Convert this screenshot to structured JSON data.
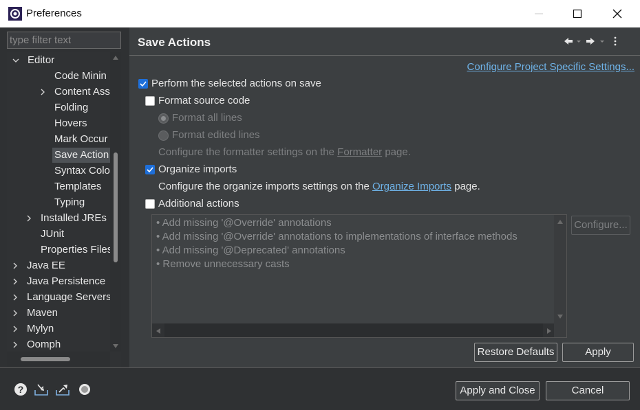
{
  "window": {
    "title": "Preferences"
  },
  "filter": {
    "placeholder": "type filter text"
  },
  "tree": {
    "items": [
      {
        "label": "Editor"
      },
      {
        "label": "Code Minin"
      },
      {
        "label": "Content Ass"
      },
      {
        "label": "Folding"
      },
      {
        "label": "Hovers"
      },
      {
        "label": "Mark Occur"
      },
      {
        "label": "Save Action"
      },
      {
        "label": "Syntax Colo"
      },
      {
        "label": "Templates"
      },
      {
        "label": "Typing"
      },
      {
        "label": "Installed JREs"
      },
      {
        "label": "JUnit"
      },
      {
        "label": "Properties Files"
      },
      {
        "label": "Java EE"
      },
      {
        "label": "Java Persistence"
      },
      {
        "label": "Language Servers"
      },
      {
        "label": "Maven"
      },
      {
        "label": "Mylyn"
      },
      {
        "label": "Oomph"
      }
    ],
    "selected": "Save Action"
  },
  "page": {
    "title": "Save Actions",
    "project_link": "Configure Project Specific Settings...",
    "perform_label": "Perform the selected actions on save",
    "format_source": "Format source code",
    "format_all": "Format all lines",
    "format_edited": "Format edited lines",
    "formatter_prefix": "Configure the formatter settings on the ",
    "formatter_link": "Formatter",
    "formatter_suffix": " page.",
    "organize_imports": "Organize imports",
    "organize_prefix": "Configure the organize imports settings on the ",
    "organize_link": "Organize Imports",
    "organize_suffix": " page.",
    "additional_actions": "Additional actions",
    "actions": [
      "• Add missing '@Override' annotations",
      "• Add missing '@Override' annotations to implementations of interface methods",
      "• Add missing '@Deprecated' annotations",
      "• Remove unnecessary casts"
    ],
    "configure_button": "Configure...",
    "restore_defaults": "Restore Defaults",
    "apply": "Apply"
  },
  "state": {
    "perform_checked": true,
    "format_checked": false,
    "organize_checked": true,
    "additional_checked": false
  },
  "footer": {
    "apply_close": "Apply and Close",
    "cancel": "Cancel",
    "icons": [
      "help-icon",
      "import-icon",
      "export-icon",
      "preferences-record-icon"
    ]
  },
  "colors": {
    "accent": "#1e6fd9",
    "link": "#6fb3e8"
  }
}
